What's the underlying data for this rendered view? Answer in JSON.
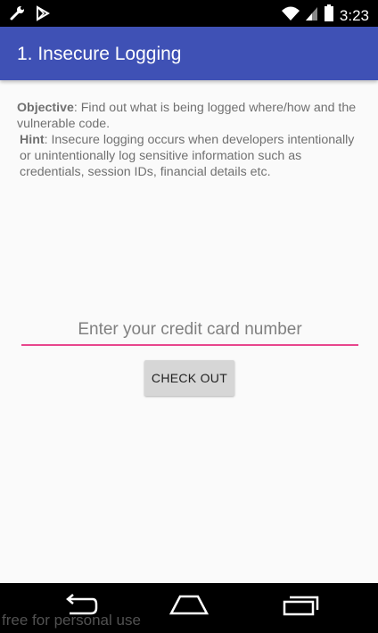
{
  "status_bar": {
    "time": "3:23",
    "icons": [
      "wrench-icon",
      "play-store-icon",
      "wifi-icon",
      "signal-icon",
      "battery-icon"
    ]
  },
  "app_bar": {
    "title": "1. Insecure Logging",
    "color": "#3f51b5"
  },
  "content": {
    "objective_label": "Objective",
    "objective_text": ": Find out what is being logged where/how and the vulnerable code.",
    "hint_label": "Hint",
    "hint_text": ": Insecure logging occurs when developers intentionally or unintentionally log sensitive information such as credentials, session IDs, financial details etc."
  },
  "form": {
    "credit_card_value": "",
    "credit_card_placeholder": "Enter your credit card number",
    "checkout_label": "CHECK OUT",
    "accent_color": "#e8468c"
  },
  "nav_bar": {
    "icons": [
      "back-icon",
      "home-icon",
      "recents-icon"
    ]
  },
  "watermark": "free for personal use"
}
